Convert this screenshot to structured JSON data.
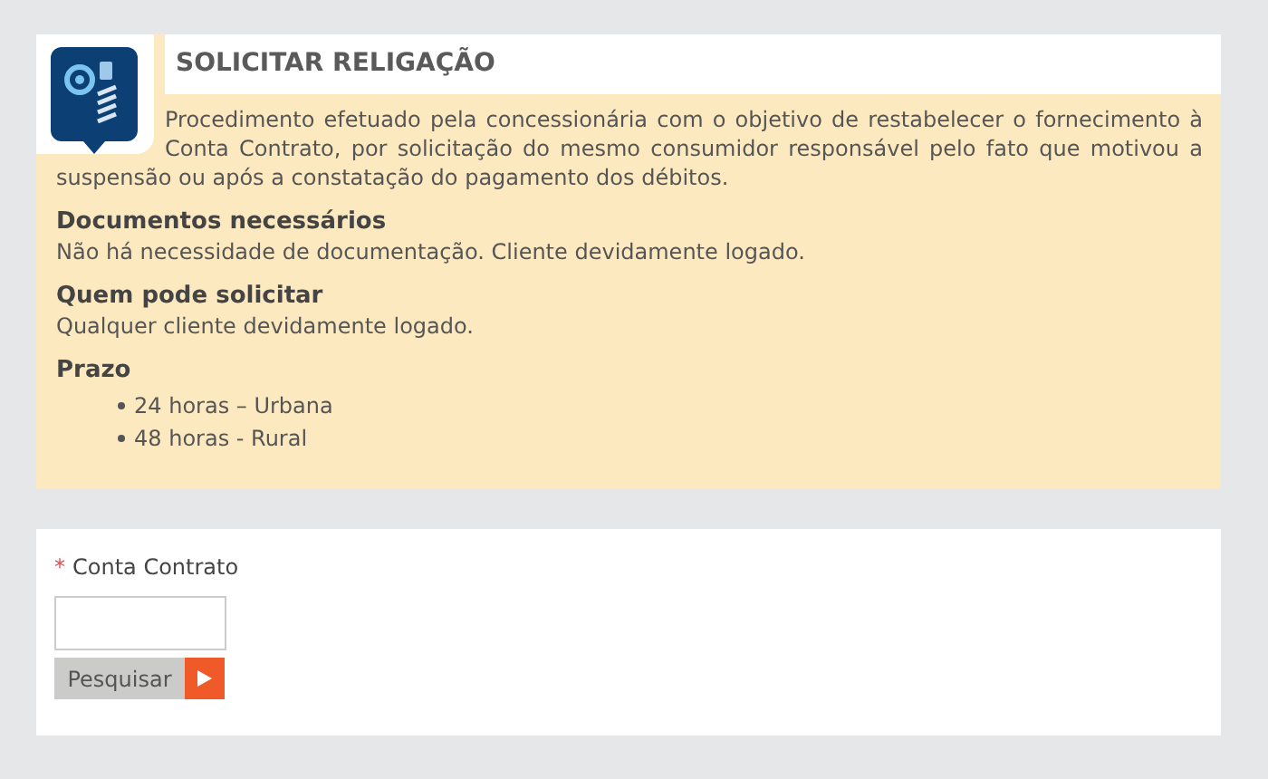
{
  "service": {
    "title": "SOLICITAR RELIGAÇÃO",
    "description": "Procedimento efetuado pela concessionária com o objetivo de restabelecer o fornecimento à Conta Contrato, por solicitação do mesmo consumidor responsável pelo fato que motivou a suspensão ou após a constatação do pagamento dos débitos.",
    "sections": [
      {
        "heading": "Documentos necessários",
        "text": "Não há necessidade de documentação. Cliente devidamente logado."
      },
      {
        "heading": "Quem pode solicitar",
        "text": "Qualquer cliente devidamente logado."
      },
      {
        "heading": "Prazo",
        "items": [
          "24 horas – Urbana",
          "48 horas - Rural"
        ]
      }
    ]
  },
  "form": {
    "required_mark": "*",
    "field_label": "Conta Contrato",
    "search_button": "Pesquisar"
  }
}
